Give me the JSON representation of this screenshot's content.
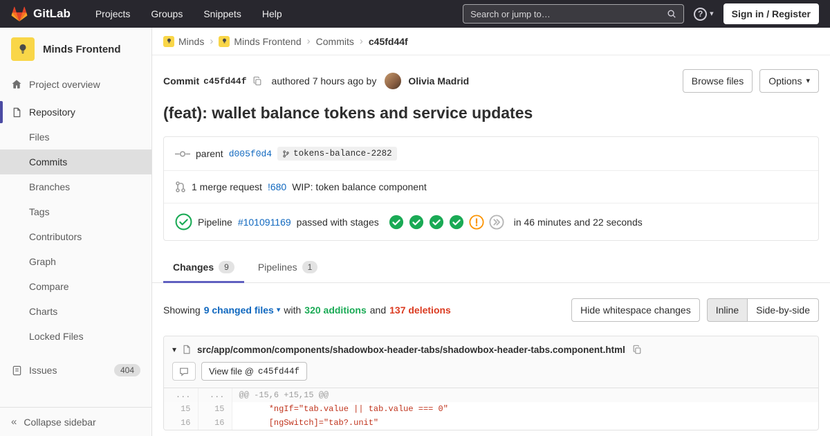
{
  "colors": {
    "navbar_bg": "#28272e",
    "link_blue": "#1068bf",
    "addition_green": "#1aaa55",
    "deletion_red": "#db3b21",
    "tab_indicator": "#6060c0",
    "sidebar_indicator": "#4b4ba3",
    "diff_syntax_red": "#c0341d"
  },
  "navbar": {
    "brand": "GitLab",
    "menu": [
      "Projects",
      "Groups",
      "Snippets",
      "Help"
    ],
    "search_placeholder": "Search or jump to…",
    "sign_in": "Sign in / Register"
  },
  "sidebar": {
    "project_name": "Minds Frontend",
    "overview_label": "Project overview",
    "repository_label": "Repository",
    "repo_subitems": [
      {
        "label": "Files",
        "active": false
      },
      {
        "label": "Commits",
        "active": true
      },
      {
        "label": "Branches",
        "active": false
      },
      {
        "label": "Tags",
        "active": false
      },
      {
        "label": "Contributors",
        "active": false
      },
      {
        "label": "Graph",
        "active": false
      },
      {
        "label": "Compare",
        "active": false
      },
      {
        "label": "Charts",
        "active": false
      },
      {
        "label": "Locked Files",
        "active": false
      }
    ],
    "issues_label": "Issues",
    "issues_count": "404",
    "collapse_label": "Collapse sidebar"
  },
  "breadcrumb": {
    "items": [
      "Minds",
      "Minds Frontend",
      "Commits",
      "c45fd44f"
    ]
  },
  "commit": {
    "label": "Commit",
    "sha": "c45fd44f",
    "authored": "authored 7 hours ago by",
    "author": "Olivia Madrid",
    "browse_files": "Browse files",
    "options": "Options",
    "title": "(feat): wallet balance tokens and service updates",
    "parent_label": "parent",
    "parent_sha": "d005f0d4",
    "branch": "tokens-balance-2282",
    "mr_prefix": "1 merge request",
    "mr_ref": "!680",
    "mr_title": "WIP: token balance component",
    "pipeline_prefix": "Pipeline",
    "pipeline_id": "#101091169",
    "pipeline_status": "passed with stages",
    "pipeline_stages": [
      "success",
      "success",
      "success",
      "success",
      "warning",
      "skipped"
    ],
    "pipeline_duration": "in 46 minutes and 22 seconds"
  },
  "tabs": {
    "changes_label": "Changes",
    "changes_count": "9",
    "pipelines_label": "Pipelines",
    "pipelines_count": "1"
  },
  "diffbar": {
    "showing": "Showing",
    "files_link": "9 changed files",
    "with_text": "with",
    "additions": "320 additions",
    "and_text": "and",
    "deletions": "137 deletions",
    "hide_whitespace": "Hide whitespace changes",
    "inline": "Inline",
    "side_by_side": "Side-by-side"
  },
  "diff_file": {
    "path": "src/app/common/components/shadowbox-header-tabs/shadowbox-header-tabs.component.html",
    "view_file_label": "View file @",
    "view_file_sha": "c45fd44f",
    "lines": [
      {
        "old": "...",
        "new": "...",
        "code": "@@ -15,6 +15,15 @@",
        "type": "hunk"
      },
      {
        "old": "15",
        "new": "15",
        "code": "      *ngIf=\"tab.value || tab.value === 0\"",
        "type": "context"
      },
      {
        "old": "16",
        "new": "16",
        "code": "      [ngSwitch]=\"tab?.unit\"",
        "type": "context"
      }
    ]
  }
}
